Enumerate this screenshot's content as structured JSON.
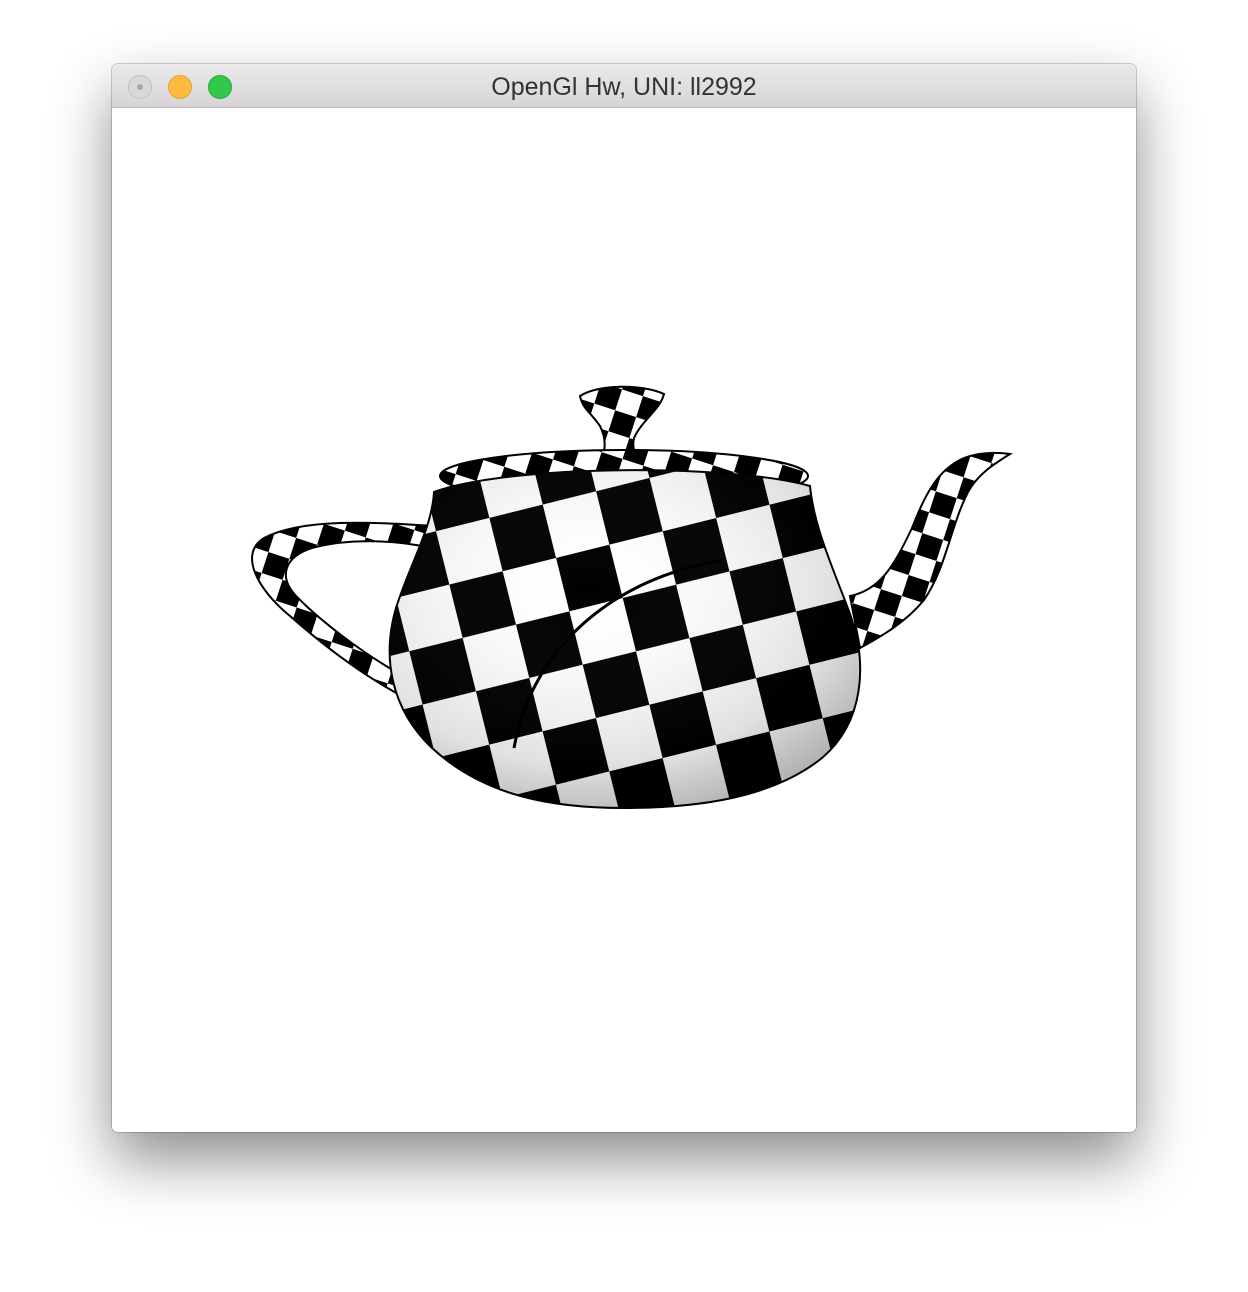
{
  "window": {
    "title": "OpenGl Hw, UNI: ll2992"
  },
  "icons": {
    "close": "close-icon",
    "minimize": "minimize-icon",
    "maximize": "maximize-icon"
  },
  "colors": {
    "titlebar": "#e2e0e2",
    "minimize": "#fdbc40",
    "maximize": "#34c84a",
    "close_disabled": "#d9d7d9",
    "canvas_background": "#ffffff",
    "checker_dark": "#000000",
    "checker_light": "#ffffff"
  },
  "scene": {
    "object": "checkered teapot"
  }
}
